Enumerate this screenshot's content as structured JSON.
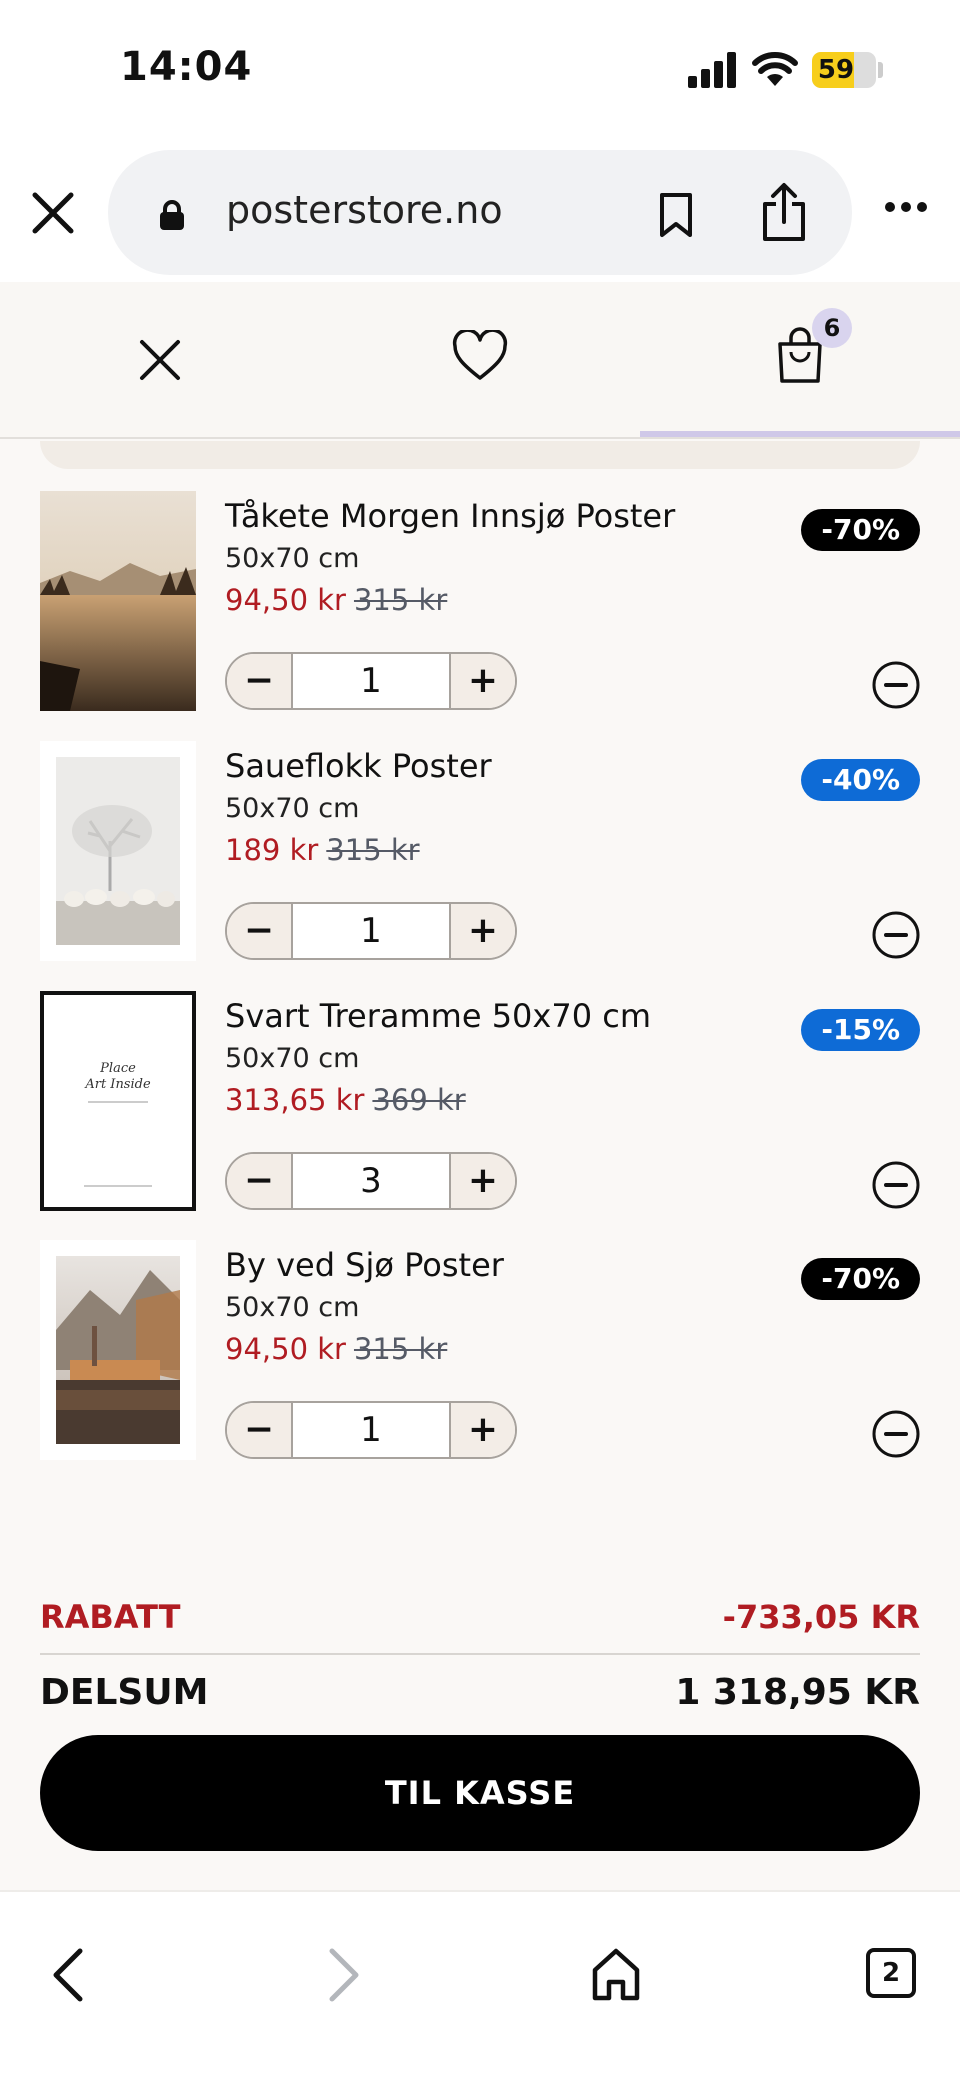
{
  "status_bar": {
    "time": "14:04",
    "battery": "59"
  },
  "browser": {
    "url": "posterstore.no"
  },
  "cart_header": {
    "bag_count": "6"
  },
  "items": [
    {
      "name": "Tåkete Morgen Innsjø Poster",
      "size": "50x70 cm",
      "price": "94,50 kr",
      "old_price": "315 kr",
      "discount": "-70%",
      "badge_color": "#000000",
      "quantity": "1"
    },
    {
      "name": "Saueflokk Poster",
      "size": "50x70 cm",
      "price": "189 kr",
      "old_price": "315 kr",
      "discount": "-40%",
      "badge_color": "#0e6bd6",
      "quantity": "1"
    },
    {
      "name": "Svart Treramme 50x70 cm",
      "size": "50x70 cm",
      "price": "313,65 kr",
      "old_price": "369 kr",
      "discount": "-15%",
      "badge_color": "#0e6bd6",
      "quantity": "3",
      "frame_text": {
        "line1": "Place",
        "line2": "Art Inside"
      }
    },
    {
      "name": "By ved Sjø Poster",
      "size": "50x70 cm",
      "price": "94,50 kr",
      "old_price": "315 kr",
      "discount": "-70%",
      "badge_color": "#000000",
      "quantity": "1"
    }
  ],
  "totals": {
    "rabatt_label": "RABATT",
    "rabatt_value": "-733,05 KR",
    "delsum_label": "DELSUM",
    "delsum_value": "1 318,95 KR"
  },
  "checkout_label": "TIL KASSE",
  "toolbar": {
    "tab_count": "2"
  },
  "colors": {
    "sale_red": "#b01c22",
    "badge_black": "#000000",
    "badge_blue": "#0e6bd6",
    "checkout_bg": "#000000"
  }
}
